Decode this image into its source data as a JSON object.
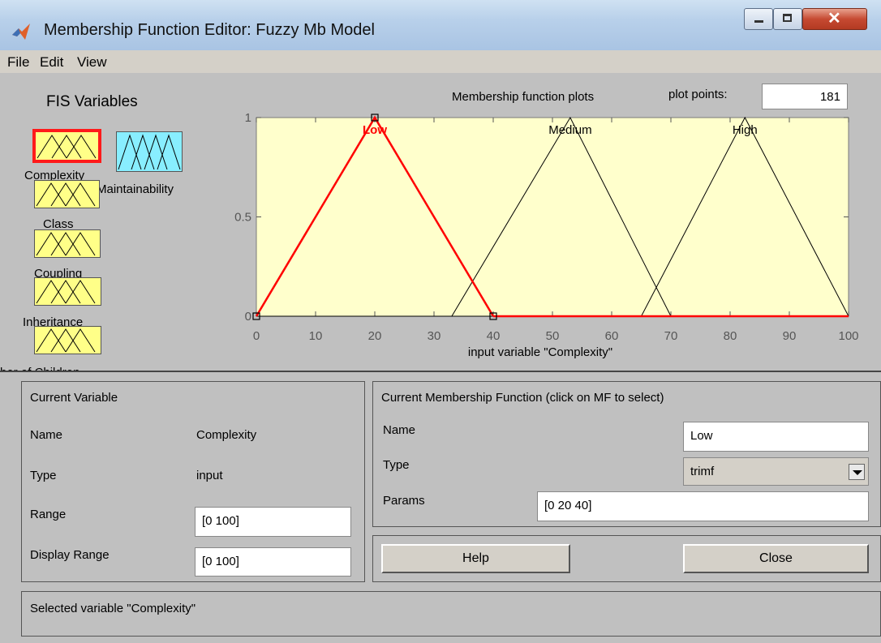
{
  "window": {
    "title": "Membership Function Editor: Fuzzy Mb Model",
    "controls": [
      "minimize",
      "maximize",
      "close"
    ]
  },
  "menu": [
    "File",
    "Edit",
    "View"
  ],
  "fis_panel": {
    "title": "FIS Variables",
    "variables": [
      {
        "label": "Complexity",
        "kind": "input",
        "selected": true
      },
      {
        "label": "Maintainability",
        "kind": "output",
        "selected": false
      },
      {
        "label": "Class",
        "kind": "input",
        "selected": false
      },
      {
        "label": "Coupling",
        "kind": "input",
        "selected": false
      },
      {
        "label": "Inheritance",
        "kind": "input",
        "selected": false
      },
      {
        "label": "ber  of    Children",
        "kind": "input",
        "selected": false
      }
    ]
  },
  "plot": {
    "title": "Membership function plots",
    "plot_points_label": "plot points:",
    "plot_points": "181"
  },
  "chart_data": {
    "type": "line",
    "xlabel": "input variable \"Complexity\"",
    "ylabel": "",
    "xlim": [
      0,
      100
    ],
    "ylim": [
      0,
      1
    ],
    "xticks": [
      0,
      10,
      20,
      30,
      40,
      50,
      60,
      70,
      80,
      90,
      100
    ],
    "yticks": [
      0,
      0.5,
      1
    ],
    "ytick_labels": [
      "0",
      "0.5",
      "1"
    ],
    "background": "#ffffcc",
    "series": [
      {
        "name": "Low",
        "color": "#ff0000",
        "selected": true,
        "x": [
          0,
          20,
          40
        ],
        "y": [
          0,
          1,
          0
        ]
      },
      {
        "name": "Medium",
        "color": "#000000",
        "selected": false,
        "x": [
          33,
          53,
          70
        ],
        "y": [
          0,
          1,
          0
        ]
      },
      {
        "name": "High",
        "color": "#000000",
        "selected": false,
        "x": [
          65,
          82.5,
          100
        ],
        "y": [
          0,
          1,
          0
        ]
      }
    ]
  },
  "current_variable": {
    "title": "Current Variable",
    "name_label": "Name",
    "name_value": "Complexity",
    "type_label": "Type",
    "type_value": "input",
    "range_label": "Range",
    "range_value": "[0 100]",
    "display_range_label": "Display Range",
    "display_range_value": "[0 100]"
  },
  "current_mf": {
    "title": "Current Membership Function (click on MF to select)",
    "name_label": "Name",
    "name_value": "Low",
    "type_label": "Type",
    "type_value": "trimf",
    "params_label": "Params",
    "params_value": "[0 20 40]"
  },
  "buttons": {
    "help": "Help",
    "close": "Close"
  },
  "status_text": "Selected variable \"Complexity\""
}
